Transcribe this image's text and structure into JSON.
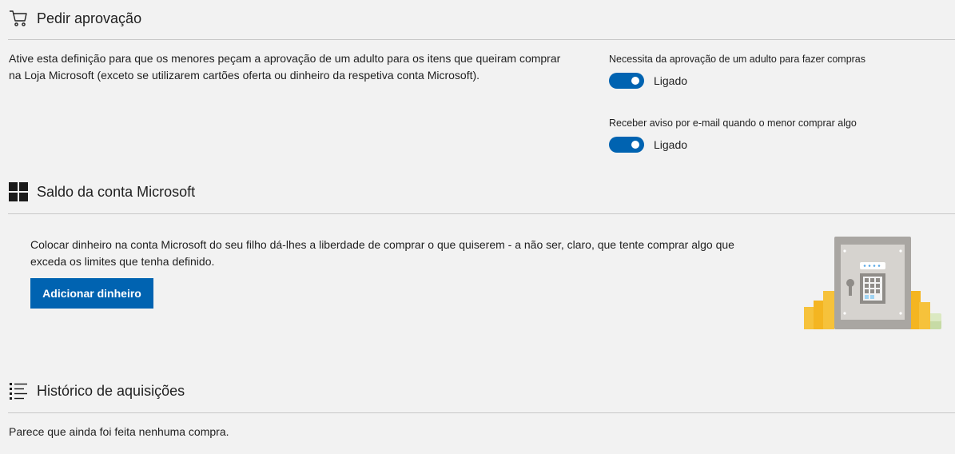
{
  "approval": {
    "title": "Pedir aprovação",
    "icon": "cart-icon",
    "description_line1": "Ative esta definição para que os menores peçam a aprovação de um adulto para os itens que queiram comprar",
    "description_line2": "na Loja Microsoft (exceto se utilizarem cartões oferta ou dinheiro da respetiva conta Microsoft).",
    "settings": [
      {
        "label": "Necessita da aprovação de um adulto para fazer compras",
        "state": "Ligado",
        "on": true
      },
      {
        "label": "Receber aviso por e-mail quando o menor comprar algo",
        "state": "Ligado",
        "on": true
      }
    ]
  },
  "balance": {
    "title": "Saldo da conta Microsoft",
    "icon": "windows-logo-icon",
    "description_line1": "Colocar dinheiro na conta Microsoft do seu filho dá-lhes a liberdade de comprar o que quiserem - a não ser, claro, que tente comprar algo que",
    "description_line2": "exceda os limites que tenha definido.",
    "button_label": "Adicionar dinheiro",
    "illustration": "safe-with-coins-illustration"
  },
  "history": {
    "title": "Histórico de aquisições",
    "icon": "list-icon",
    "empty_text": "Parece que ainda foi feita nenhuma compra."
  },
  "colors": {
    "accent": "#0063b1",
    "background": "#f2f2f2",
    "divider": "#c8c8c8"
  }
}
